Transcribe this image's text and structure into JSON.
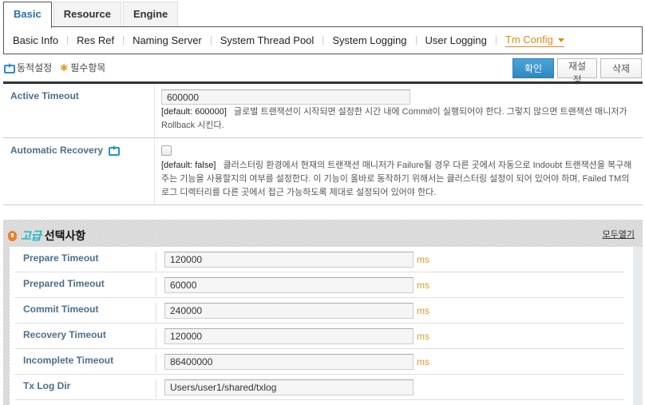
{
  "tabs": [
    {
      "label": "Basic",
      "active": true
    },
    {
      "label": "Resource",
      "active": false
    },
    {
      "label": "Engine",
      "active": false
    }
  ],
  "subnav": [
    {
      "label": "Basic Info"
    },
    {
      "label": "Res Ref"
    },
    {
      "label": "Naming Server"
    },
    {
      "label": "System Thread Pool"
    },
    {
      "label": "System Logging"
    },
    {
      "label": "User Logging"
    },
    {
      "label": "Tm Config",
      "active": true
    }
  ],
  "legend": {
    "dynamic": "동적설정",
    "required": "필수항목"
  },
  "buttons": {
    "confirm": "확인",
    "reset": "재설정",
    "delete": "삭제"
  },
  "fields": {
    "active_timeout": {
      "label": "Active Timeout",
      "value": "600000",
      "default": "[default: 600000]",
      "desc": "글로벌 트랜잭션이 시작되면 설정한 시간 내에 Commit이 실행되어야 한다. 그렇지 않으면 트랜잭션 매니저가 Rollback 시킨다."
    },
    "automatic_recovery": {
      "label": "Automatic Recovery",
      "checked": false,
      "default": "[default: false]",
      "desc": "클러스터링 환경에서 현재의 트랜잭션 매니저가 Failure될 경우 다른 곳에서 자동으로 Indoubt 트랜잭션을 복구해주는 기능을 사용할지의 여부를 설정한다. 이 기능이 올바로 동작하기 위해서는 클러스터링 설정이 되어 있어야 하며, Failed TM의 로그 디렉터리를 다른 곳에서 접근 가능하도록 제대로 설정되어 있어야 한다."
    }
  },
  "advanced": {
    "title_highlight": "고급",
    "title": "선택사항",
    "open_all": "모두열기",
    "rows": [
      {
        "label": "Prepare Timeout",
        "value": "120000",
        "unit": "ms"
      },
      {
        "label": "Prepared Timeout",
        "value": "60000",
        "unit": "ms"
      },
      {
        "label": "Commit Timeout",
        "value": "240000",
        "unit": "ms"
      },
      {
        "label": "Recovery Timeout",
        "value": "120000",
        "unit": "ms"
      },
      {
        "label": "Incomplete Timeout",
        "value": "86400000",
        "unit": "ms"
      },
      {
        "label": "Tx Log Dir",
        "value": "Users/user1/shared/txlog",
        "unit": ""
      }
    ]
  }
}
